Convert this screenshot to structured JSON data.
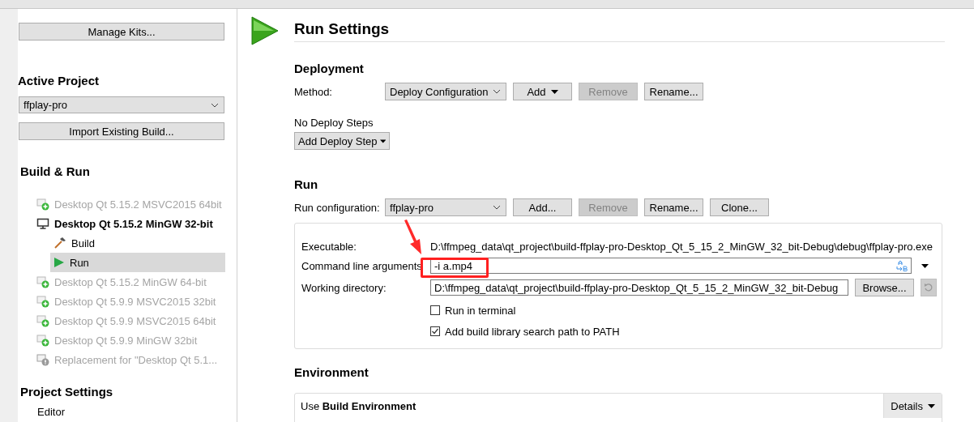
{
  "sidebar": {
    "manage_kits_button": "Manage Kits...",
    "active_project": {
      "heading": "Active Project",
      "combo": "ffplay-pro",
      "import_button": "Import Existing Build..."
    },
    "build_run": {
      "heading": "Build & Run",
      "kits": [
        {
          "label": "Desktop Qt 5.15.2 MSVC2015 64bit",
          "kind": "add",
          "enabled": false,
          "active": false
        },
        {
          "label": "Desktop Qt 5.15.2 MinGW 32-bit",
          "kind": "monitor",
          "enabled": true,
          "active": true,
          "children": [
            {
              "label": "Build",
              "kind": "build",
              "selected": false
            },
            {
              "label": "Run",
              "kind": "run",
              "selected": true
            }
          ]
        },
        {
          "label": "Desktop Qt 5.15.2 MinGW 64-bit",
          "kind": "add",
          "enabled": false,
          "active": false
        },
        {
          "label": "Desktop Qt 5.9.9 MSVC2015 32bit",
          "kind": "add",
          "enabled": false,
          "active": false
        },
        {
          "label": "Desktop Qt 5.9.9 MSVC2015 64bit",
          "kind": "add",
          "enabled": false,
          "active": false
        },
        {
          "label": "Desktop Qt 5.9.9 MinGW 32bit",
          "kind": "add",
          "enabled": false,
          "active": false
        },
        {
          "label": "Replacement for \"Desktop Qt 5.1...",
          "kind": "warning",
          "enabled": false,
          "active": false
        }
      ]
    },
    "project_settings": {
      "heading": "Project Settings",
      "items": [
        "Editor"
      ]
    }
  },
  "main": {
    "title": "Run Settings",
    "deployment": {
      "heading": "Deployment",
      "method_label": "Method:",
      "method_combo": "Deploy Configuration",
      "buttons": [
        {
          "label": "Add",
          "kind": "menu",
          "disabled": false
        },
        {
          "label": "Remove",
          "kind": "plain",
          "disabled": true
        },
        {
          "label": "Rename...",
          "kind": "plain",
          "disabled": false
        }
      ],
      "steps_label": "No Deploy Steps",
      "add_step_button": "Add Deploy Step"
    },
    "run": {
      "heading": "Run",
      "config_label": "Run configuration:",
      "config_combo": "ffplay-pro",
      "buttons": [
        {
          "label": "Add...",
          "kind": "plain",
          "disabled": false
        },
        {
          "label": "Remove",
          "kind": "plain",
          "disabled": true
        },
        {
          "label": "Rename...",
          "kind": "plain",
          "disabled": false
        },
        {
          "label": "Clone...",
          "kind": "plain",
          "disabled": false
        }
      ],
      "executable_label": "Executable:",
      "executable": "D:\\ffmpeg_data\\qt_project\\build-ffplay-pro-Desktop_Qt_5_15_2_MinGW_32_bit-Debug\\debug\\ffplay-pro.exe",
      "arguments_label": "Command line arguments",
      "arguments": "-i a.mp4",
      "workdir_label": "Working directory:",
      "workdir": "D:\\ffmpeg_data\\qt_project\\build-ffplay-pro-Desktop_Qt_5_15_2_MinGW_32_bit-Debug",
      "browse_button": "Browse...",
      "checkboxes": [
        {
          "label": "Run in terminal",
          "checked": false
        },
        {
          "label": "Add build library search path to PATH",
          "checked": true
        }
      ]
    },
    "environment": {
      "heading": "Environment",
      "use_label": "Use **Build Environment**",
      "details_button": "Details"
    }
  }
}
